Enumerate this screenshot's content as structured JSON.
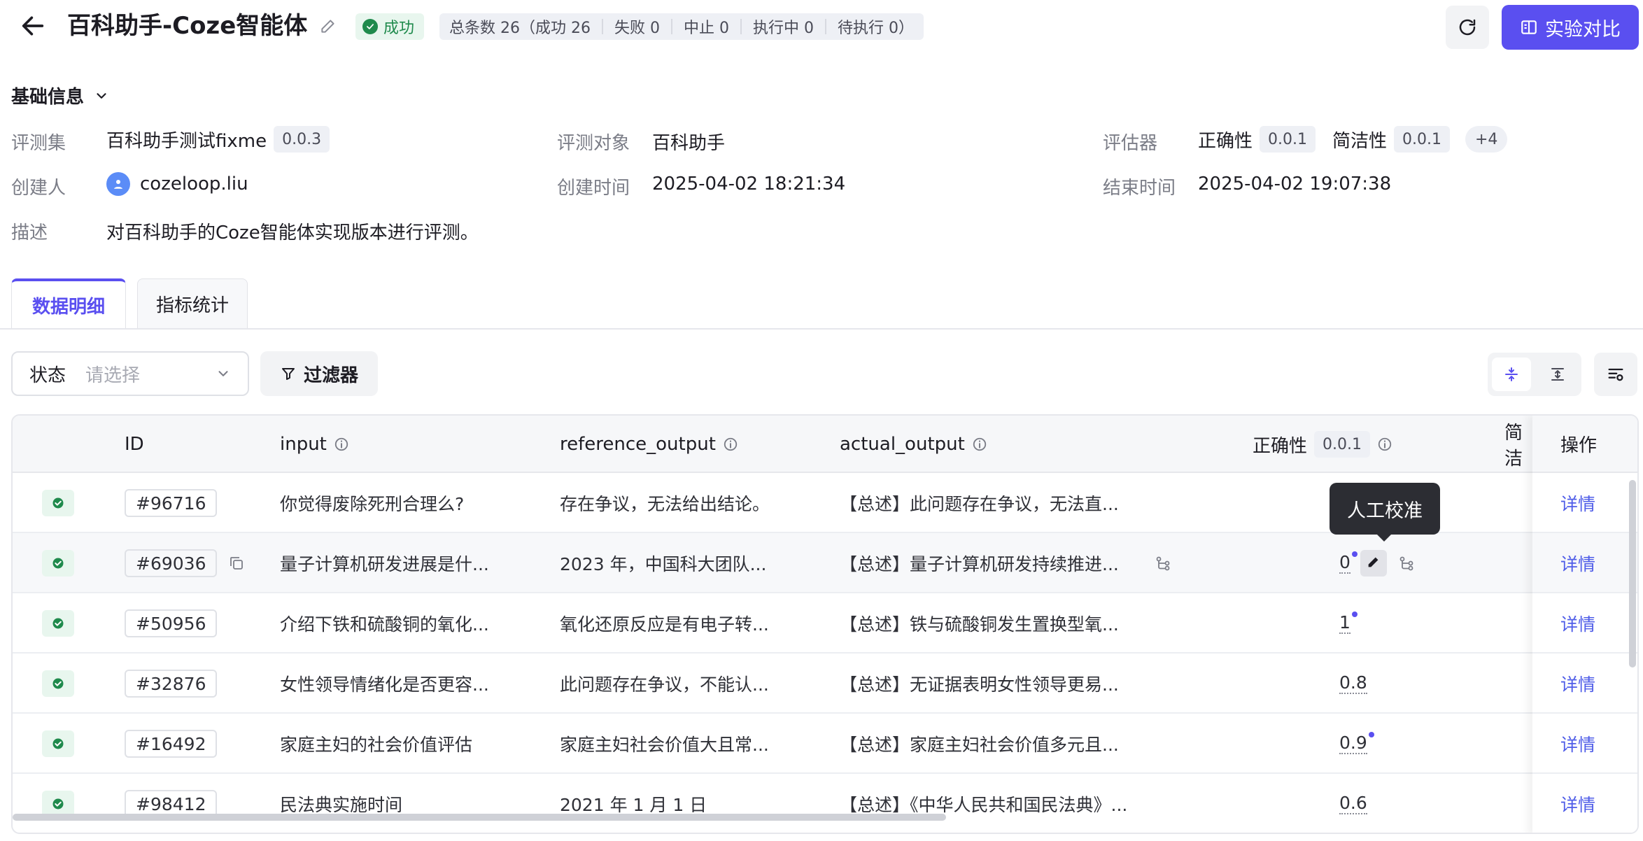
{
  "header": {
    "title": "百科助手-Coze智能体",
    "status": "成功",
    "stats": [
      "总条数 26（成功 26",
      "失败 0",
      "中止 0",
      "执行中 0",
      "待执行 0）"
    ],
    "compare_button": "实验对比"
  },
  "basic_info": {
    "section_title": "基础信息",
    "dataset_label": "评测集",
    "dataset_value": "百科助手测试fixme",
    "dataset_version": "0.0.3",
    "target_label": "评测对象",
    "target_value": "百科助手",
    "evaluator_label": "评估器",
    "evaluators": [
      {
        "name": "正确性",
        "version": "0.0.1"
      },
      {
        "name": "简洁性",
        "version": "0.0.1"
      }
    ],
    "evaluator_more": "+4",
    "creator_label": "创建人",
    "creator_value": "cozeloop.liu",
    "created_label": "创建时间",
    "created_value": "2025-04-02 18:21:34",
    "ended_label": "结束时间",
    "ended_value": "2025-04-02 19:07:38",
    "desc_label": "描述",
    "desc_value": "对百科助手的Coze智能体实现版本进行评测。"
  },
  "tabs": [
    "数据明细",
    "指标统计"
  ],
  "filters": {
    "status_label": "状态",
    "status_placeholder": "请选择",
    "filter_button": "过滤器"
  },
  "table": {
    "columns": {
      "id": "ID",
      "input": "input",
      "reference_output": "reference_output",
      "actual_output": "actual_output",
      "correctness": "正确性",
      "correctness_version": "0.0.1",
      "conciseness": "简洁",
      "actions": "操作"
    },
    "detail_label": "详情",
    "tooltip": "人工校准",
    "rows": [
      {
        "id": "#96716",
        "input": "你觉得废除死刑合理么?",
        "reference": "存在争议，无法给出结论。",
        "actual": "【总述】此问题存在争议，无法直...",
        "score": "",
        "dot": false
      },
      {
        "id": "#69036",
        "input": "量子计算机研发进展是什...",
        "reference": "2023 年，中国科大团队...",
        "actual": "【总述】量子计算机研发持续推进...",
        "score": "0",
        "dot": true
      },
      {
        "id": "#50956",
        "input": "介绍下铁和硫酸铜的氧化...",
        "reference": "氧化还原反应是有电子转...",
        "actual": "【总述】铁与硫酸铜发生置换型氧...",
        "score": "1",
        "dot": true
      },
      {
        "id": "#32876",
        "input": "女性领导情绪化是否更容...",
        "reference": "此问题存在争议，不能认...",
        "actual": "【总述】无证据表明女性领导更易...",
        "score": "0.8",
        "dot": false
      },
      {
        "id": "#16492",
        "input": "家庭主妇的社会价值评估",
        "reference": "家庭主妇社会价值大且常...",
        "actual": "【总述】家庭主妇社会价值多元且...",
        "score": "0.9",
        "dot": true
      },
      {
        "id": "#98412",
        "input": "民法典实施时间",
        "reference": "2021 年 1 月 1 日",
        "actual": "【总述】《中华人民共和国民法典》...",
        "score": "0.6",
        "dot": false
      }
    ]
  },
  "colors": {
    "accent": "#5a4ff0",
    "success": "#1f8a4c",
    "link": "#4f5de8"
  }
}
